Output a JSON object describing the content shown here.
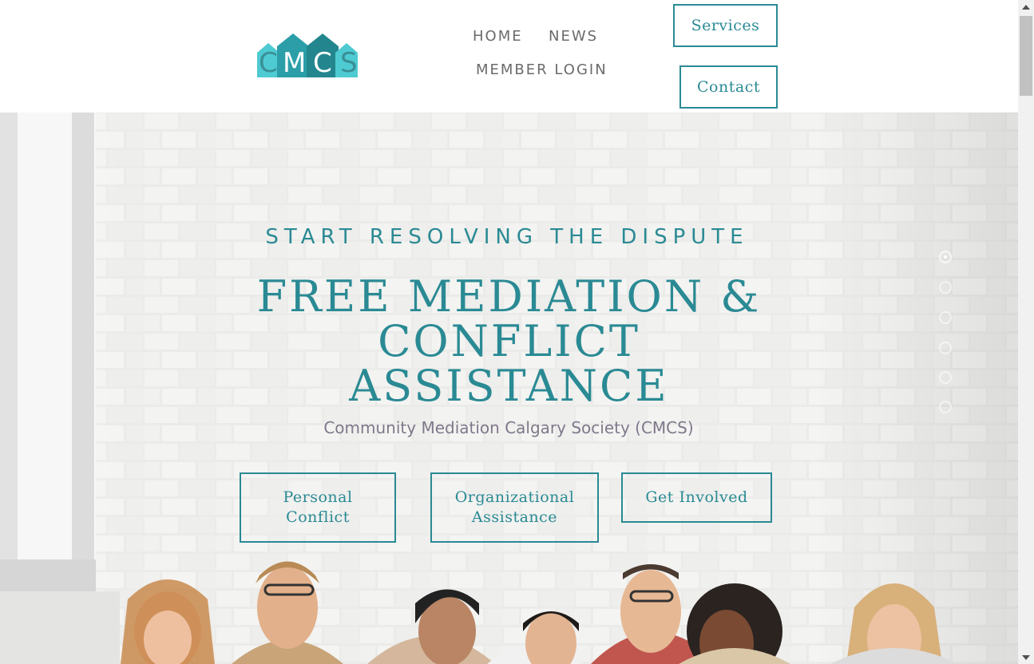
{
  "header": {
    "logo_letters": [
      "C",
      "M",
      "C",
      "S"
    ],
    "nav": {
      "home": "HOME",
      "news": "NEWS",
      "member_login": "MEMBER LOGIN"
    },
    "buttons": {
      "services": "Services",
      "contact": "Contact"
    }
  },
  "hero": {
    "kicker": "START RESOLVING THE DISPUTE",
    "title": "FREE MEDIATION & CONFLICT ASSISTANCE",
    "subtitle": "Community Mediation Calgary Society (CMCS)",
    "buttons": {
      "personal_line1": "Personal",
      "personal_line2": "Conflict",
      "organizational_line1": "Organizational",
      "organizational_line2": "Assistance",
      "involved": "Get Involved"
    },
    "slider": {
      "slide_count": 6,
      "active_slide": 1
    }
  },
  "colors": {
    "accent": "#2a8a94",
    "logo_teal": "#3cc4cc",
    "logo_dark": "#1f8a94",
    "subtitle": "#80788a",
    "nav_text": "#6b6b6b"
  },
  "icons": [
    "logo-houses-icon",
    "chevron-up-icon",
    "chevron-down-icon"
  ]
}
